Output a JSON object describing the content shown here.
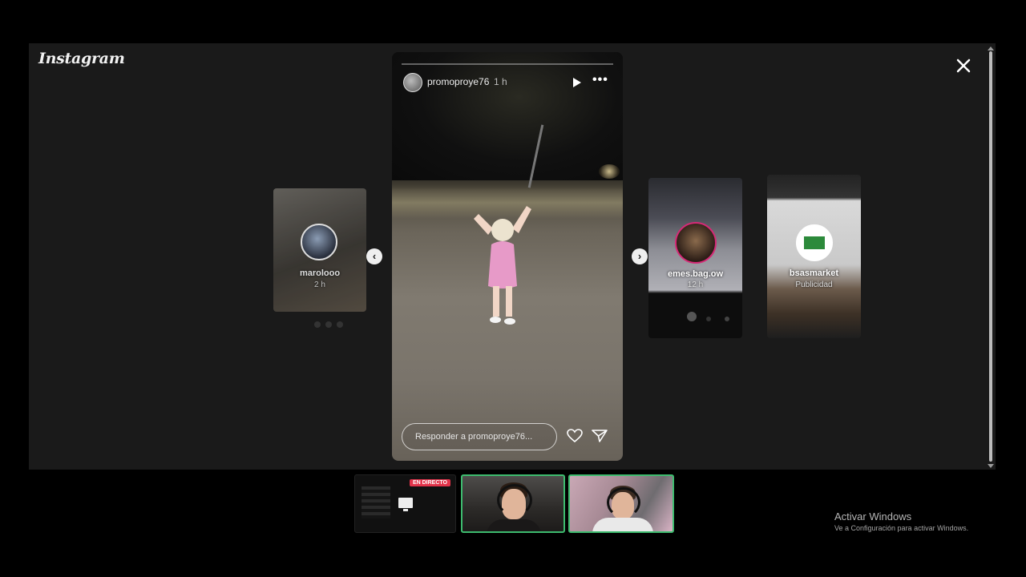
{
  "app": {
    "logo_text": "Instagram",
    "close_icon": "close-icon"
  },
  "story": {
    "username": "promoproye76",
    "time": "1 h",
    "reply_placeholder": "Responder a promoproye76...",
    "icons": [
      "play-icon",
      "more-icon",
      "heart-icon",
      "send-icon"
    ]
  },
  "previews": [
    {
      "username": "marolooo",
      "time": "2 h"
    },
    {
      "username": "emes.bag.ow",
      "time": "12 h"
    },
    {
      "username": "bsasmarket",
      "time": "Publicidad"
    }
  ],
  "streamer_bar": {
    "live_badge": "EN DIRECTO",
    "border_color": "#3dbb6e",
    "badge_color": "#e2334a"
  },
  "watermark": {
    "title": "Activar Windows",
    "subtitle": "Ve a Configuración para activar Windows."
  }
}
